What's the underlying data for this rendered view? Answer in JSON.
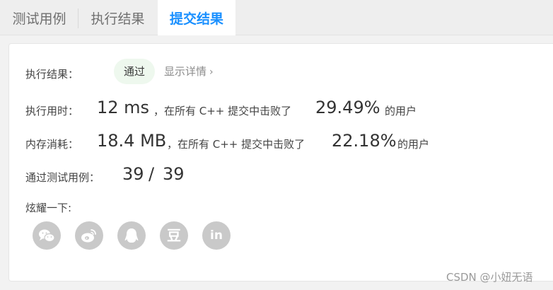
{
  "tabs": [
    "测试用例",
    "执行结果",
    "提交结果"
  ],
  "result": {
    "label": "执行结果：",
    "status": "通过",
    "detail_link": "显示详情",
    "chevron": "›"
  },
  "runtime": {
    "label": "执行用时：",
    "value": "12 ms",
    "text": "，在所有 C++ 提交中击败了",
    "percent": "29.49%",
    "suffix": "的用户"
  },
  "memory": {
    "label": "内存消耗：",
    "value": "18.4 MB",
    "text": "，在所有 C++ 提交中击败了",
    "percent": "22.18%",
    "suffix": "的用户"
  },
  "tests": {
    "label": "通过测试用例：",
    "passed": "39",
    "sep": "/",
    "total": "39"
  },
  "share": {
    "label": "炫耀一下:",
    "icons": [
      "wechat-icon",
      "weibo-icon",
      "qq-icon",
      "douban-icon",
      "linkedin-icon"
    ],
    "douban_glyph": "豆",
    "linkedin_glyph": "in",
    "icon_color": "#c9c9c9"
  },
  "watermark": "CSDN @小妞无语",
  "colors": {
    "accent": "#1a90ff",
    "badge_bg": "#eef8ee"
  }
}
